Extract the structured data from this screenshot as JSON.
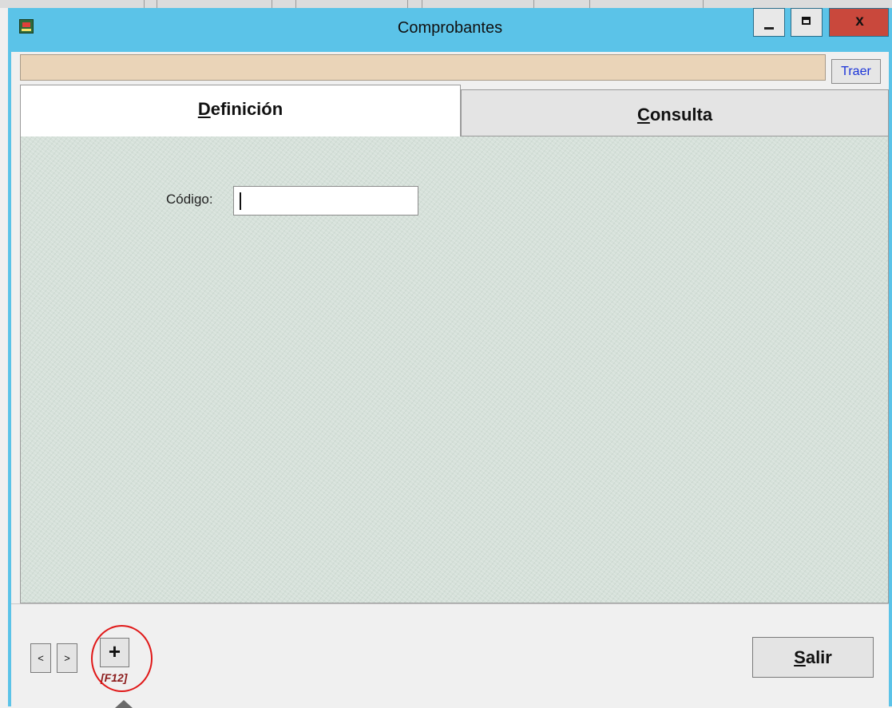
{
  "window": {
    "title": "Comprobantes",
    "close_glyph": "x"
  },
  "header": {
    "search_value": "",
    "traer_label": "Traer"
  },
  "tabs": [
    {
      "underline": "D",
      "rest": "efinición",
      "active": true
    },
    {
      "underline": "C",
      "rest": "onsulta",
      "active": false
    }
  ],
  "form": {
    "codigo_label": "Código:",
    "codigo_value": ""
  },
  "footer": {
    "prev_label": "<",
    "next_label": ">",
    "add_label": "+",
    "add_hotkey": "[F12]",
    "salir_underline": "S",
    "salir_rest": "alir"
  },
  "colors": {
    "titlebar": "#5bc3e8",
    "close_button": "#c9483c",
    "search_field": "#ead4b8",
    "panel": "#d6e1da",
    "highlight": "#e01818"
  }
}
